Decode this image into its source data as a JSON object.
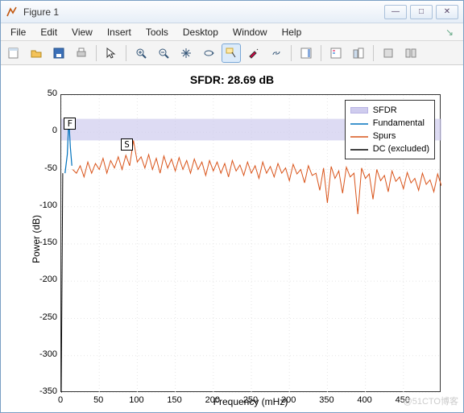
{
  "window": {
    "title": "Figure 1",
    "buttons": {
      "minimize": "—",
      "maximize": "□",
      "close": "✕"
    }
  },
  "menu": {
    "items": [
      "File",
      "Edit",
      "View",
      "Insert",
      "Tools",
      "Desktop",
      "Window",
      "Help"
    ],
    "dock_tip": "↘"
  },
  "toolbar_icons": [
    "new-figure-icon",
    "open-icon",
    "save-icon",
    "print-icon",
    "|",
    "pointer-icon",
    "|",
    "zoom-in-icon",
    "zoom-out-icon",
    "pan-icon",
    "rotate3d-icon",
    "data-cursor-icon",
    "brush-icon",
    "link-icon",
    "|",
    "colorbar-icon",
    "|",
    "insert-legend-icon",
    "plot-tools-icon",
    "|",
    "hide-tools-icon",
    "show-tools-icon"
  ],
  "chart_data": {
    "type": "line",
    "title": "SFDR:  28.69 dB",
    "xlabel": "Frequency (mHz)",
    "ylabel": "Power (dB)",
    "xlim": [
      0,
      500
    ],
    "ylim": [
      -350,
      50
    ],
    "xticks": [
      0,
      50,
      100,
      150,
      200,
      250,
      300,
      350,
      400,
      450
    ],
    "yticks": [
      50,
      0,
      -50,
      -100,
      -150,
      -200,
      -250,
      -300,
      -350
    ],
    "sfdr_band": {
      "ymin": -11,
      "ymax": 18
    },
    "series": [
      {
        "name": "SFDR",
        "type": "area",
        "color": "#cfccee"
      },
      {
        "name": "Fundamental",
        "type": "line",
        "color": "#0072bd",
        "x": [
          5,
          8,
          10,
          12,
          14
        ],
        "y": [
          -55,
          -30,
          18,
          -20,
          -45
        ]
      },
      {
        "name": "Spurs",
        "type": "line",
        "color": "#d95319",
        "x": [
          15,
          20,
          25,
          30,
          35,
          40,
          45,
          50,
          55,
          60,
          65,
          70,
          75,
          80,
          85,
          90,
          95,
          100,
          105,
          110,
          115,
          120,
          125,
          130,
          135,
          140,
          145,
          150,
          155,
          160,
          165,
          170,
          175,
          180,
          185,
          190,
          195,
          200,
          205,
          210,
          215,
          220,
          225,
          230,
          235,
          240,
          245,
          250,
          255,
          260,
          265,
          270,
          275,
          280,
          285,
          290,
          295,
          300,
          305,
          310,
          315,
          320,
          325,
          330,
          335,
          340,
          345,
          350,
          355,
          360,
          365,
          370,
          375,
          380,
          385,
          390,
          395,
          400,
          405,
          410,
          415,
          420,
          425,
          430,
          435,
          440,
          445,
          450,
          455,
          460,
          465,
          470,
          475,
          480,
          485,
          490,
          495,
          500
        ],
        "y": [
          -50,
          -55,
          -45,
          -60,
          -40,
          -55,
          -42,
          -50,
          -35,
          -55,
          -38,
          -48,
          -33,
          -50,
          -31,
          -45,
          -11,
          -40,
          -33,
          -48,
          -30,
          -50,
          -35,
          -55,
          -32,
          -48,
          -36,
          -52,
          -34,
          -50,
          -38,
          -55,
          -36,
          -50,
          -40,
          -58,
          -38,
          -52,
          -40,
          -55,
          -42,
          -60,
          -38,
          -52,
          -44,
          -58,
          -40,
          -55,
          -45,
          -62,
          -40,
          -55,
          -46,
          -60,
          -42,
          -55,
          -48,
          -65,
          -43,
          -56,
          -50,
          -68,
          -45,
          -58,
          -55,
          -78,
          -48,
          -95,
          -46,
          -62,
          -52,
          -82,
          -47,
          -60,
          -55,
          -110,
          -48,
          -62,
          -56,
          -90,
          -50,
          -65,
          -58,
          -80,
          -52,
          -66,
          -60,
          -76,
          -54,
          -68,
          -62,
          -78,
          -55,
          -70,
          -64,
          -80,
          -56,
          -72
        ]
      },
      {
        "name": "DC (excluded)",
        "type": "line",
        "color": "#000000",
        "x": [
          0,
          2
        ],
        "y": [
          -350,
          -55
        ]
      }
    ],
    "legend": [
      "SFDR",
      "Fundamental",
      "Spurs",
      "DC (excluded)"
    ],
    "markers": [
      {
        "label": "F",
        "x": 10,
        "y": 18
      },
      {
        "label": "S",
        "x": 85,
        "y": -11
      }
    ]
  },
  "watermark": "@51CTO博客"
}
